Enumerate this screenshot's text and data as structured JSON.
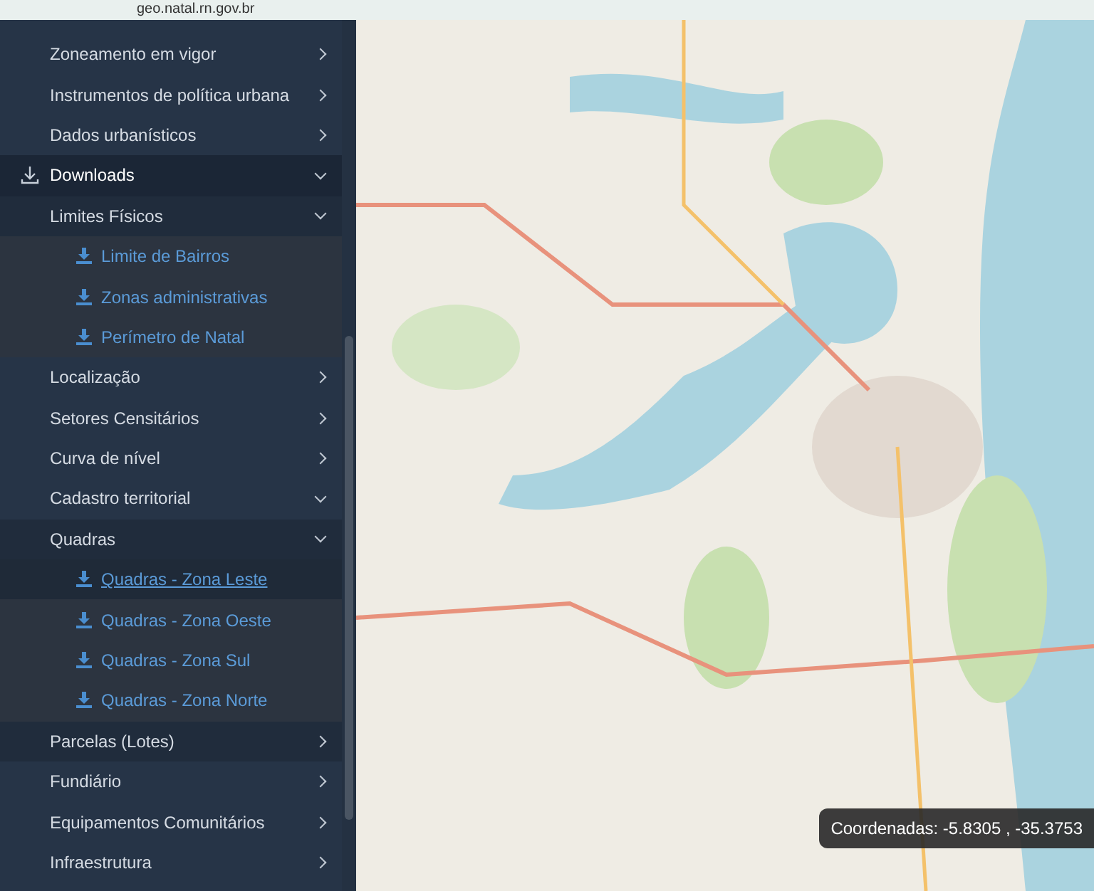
{
  "browser": {
    "url": "geo.natal.rn.gov.br"
  },
  "sidebar": {
    "items": [
      {
        "kind": "group",
        "label": "Zoneamento em vigor",
        "expanded": false
      },
      {
        "kind": "group",
        "label": "Instrumentos de política urbana",
        "expanded": false
      },
      {
        "kind": "group",
        "label": "Dados urbanísticos",
        "expanded": false
      },
      {
        "kind": "section",
        "label": "Downloads",
        "expanded": true,
        "children": [
          {
            "kind": "group",
            "label": "Limites Físicos",
            "expanded": true,
            "children": [
              {
                "kind": "link",
                "label": "Limite de Bairros",
                "selected": false
              },
              {
                "kind": "link",
                "label": "Zonas administrativas",
                "selected": false
              },
              {
                "kind": "link",
                "label": "Perímetro de Natal",
                "selected": false
              }
            ]
          }
        ]
      },
      {
        "kind": "group",
        "label": "Localização",
        "expanded": false
      },
      {
        "kind": "group",
        "label": "Setores Censitários",
        "expanded": false
      },
      {
        "kind": "group",
        "label": "Curva de nível",
        "expanded": false
      },
      {
        "kind": "group",
        "label": "Cadastro territorial",
        "expanded": true,
        "children": [
          {
            "kind": "group",
            "label": "Quadras",
            "expanded": true,
            "children": [
              {
                "kind": "link",
                "label": "Quadras - Zona Leste",
                "selected": true
              },
              {
                "kind": "link",
                "label": "Quadras - Zona Oeste",
                "selected": false
              },
              {
                "kind": "link",
                "label": "Quadras - Zona Sul",
                "selected": false
              },
              {
                "kind": "link",
                "label": "Quadras - Zona Norte",
                "selected": false
              }
            ]
          },
          {
            "kind": "group",
            "label": "Parcelas (Lotes)",
            "expanded": false
          }
        ]
      },
      {
        "kind": "group",
        "label": "Fundiário",
        "expanded": false
      },
      {
        "kind": "group",
        "label": "Equipamentos Comunitários",
        "expanded": false
      },
      {
        "kind": "group",
        "label": "Infraestrutura",
        "expanded": false
      }
    ]
  },
  "map": {
    "coordinates": "Coordenadas: -5.8305 , -35.3753"
  }
}
